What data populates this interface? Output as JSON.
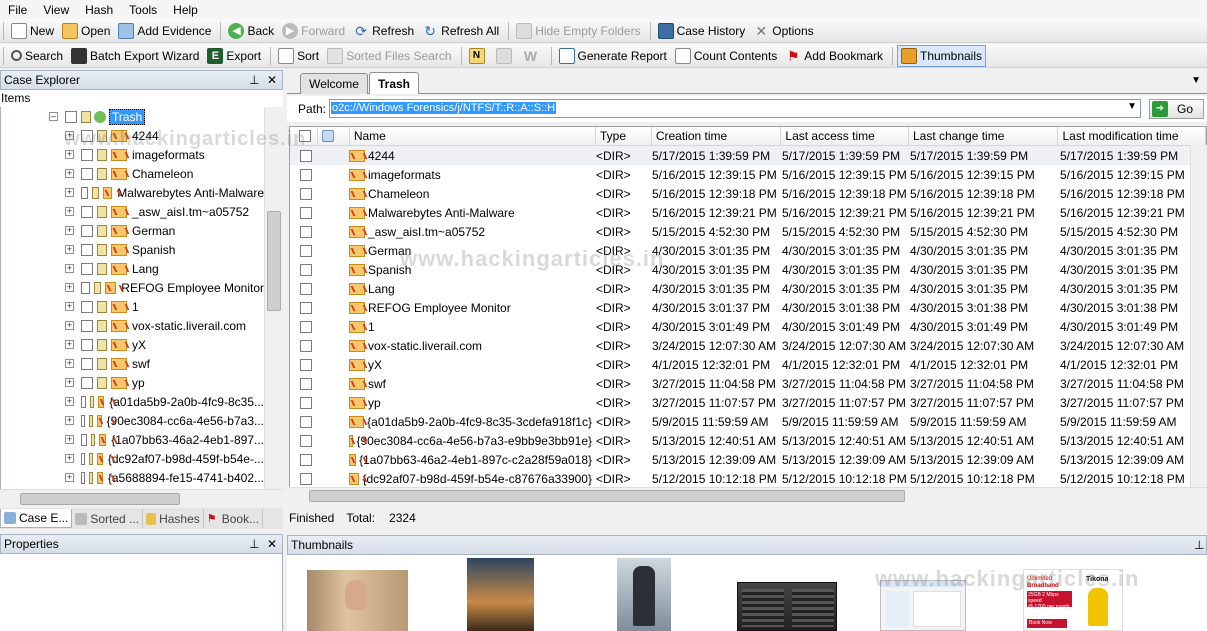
{
  "menu": [
    "File",
    "View",
    "Hash",
    "Tools",
    "Help"
  ],
  "toolbar1": {
    "new": "New",
    "open": "Open",
    "add_evidence": "Add Evidence",
    "back": "Back",
    "forward": "Forward",
    "refresh": "Refresh",
    "refresh_all": "Refresh All",
    "hide_empty": "Hide Empty Folders",
    "case_history": "Case History",
    "options": "Options"
  },
  "toolbar2": {
    "search": "Search",
    "batch_export": "Batch Export Wizard",
    "export": "Export",
    "sort": "Sort",
    "sorted_files_search": "Sorted Files Search",
    "generate_report": "Generate Report",
    "count_contents": "Count Contents",
    "add_bookmark": "Add Bookmark",
    "thumbnails": "Thumbnails"
  },
  "case_explorer": {
    "title": "Case Explorer",
    "items_label": "Items",
    "root": "Trash",
    "nodes": [
      "4244",
      "imageformats",
      "Chameleon",
      "Malwarebytes Anti-Malware",
      "_asw_aisI.tm~a05752",
      "German",
      "Spanish",
      "Lang",
      "REFOG Employee Monitor",
      "1",
      "vox-static.liverail.com",
      "yX",
      "swf",
      "yp",
      "{a01da5b9-2a0b-4fc9-8c35...",
      "{90ec3084-cc6a-4e56-b7a3...",
      "{1a07bb63-46a2-4eb1-897...",
      "{dc92af07-b98d-459f-b54e-...",
      "{a5688894-fe15-4741-b402..."
    ]
  },
  "left_tabs": [
    "Case E...",
    "Sorted ...",
    "Hashes",
    "Book..."
  ],
  "properties": {
    "title": "Properties"
  },
  "tabs": [
    "Welcome",
    "Trash"
  ],
  "path": {
    "label": "Path:",
    "value": "o2c://Windows Forensics/j/NTFS/T::R::A::S::H",
    "go": "Go"
  },
  "grid": {
    "headers": [
      "Name",
      "Type",
      "Creation time",
      "Last access time",
      "Last change time",
      "Last modification time"
    ],
    "rows": [
      [
        "4244",
        "<DIR>",
        "5/17/2015  1:39:59 PM",
        "5/17/2015  1:39:59 PM",
        "5/17/2015  1:39:59 PM",
        "5/17/2015  1:39:59 PM"
      ],
      [
        "imageformats",
        "<DIR>",
        "5/16/2015  12:39:15 PM",
        "5/16/2015  12:39:15 PM",
        "5/16/2015  12:39:15 PM",
        "5/16/2015  12:39:15 PM"
      ],
      [
        "Chameleon",
        "<DIR>",
        "5/16/2015  12:39:18 PM",
        "5/16/2015  12:39:18 PM",
        "5/16/2015  12:39:18 PM",
        "5/16/2015  12:39:18 PM"
      ],
      [
        "Malwarebytes Anti-Malware",
        "<DIR>",
        "5/16/2015  12:39:21 PM",
        "5/16/2015  12:39:21 PM",
        "5/16/2015  12:39:21 PM",
        "5/16/2015  12:39:21 PM"
      ],
      [
        "_asw_aisI.tm~a05752",
        "<DIR>",
        "5/15/2015  4:52:30 PM",
        "5/15/2015  4:52:30 PM",
        "5/15/2015  4:52:30 PM",
        "5/15/2015  4:52:30 PM"
      ],
      [
        "German",
        "<DIR>",
        "4/30/2015  3:01:35 PM",
        "4/30/2015  3:01:35 PM",
        "4/30/2015  3:01:35 PM",
        "4/30/2015  3:01:35 PM"
      ],
      [
        "Spanish",
        "<DIR>",
        "4/30/2015  3:01:35 PM",
        "4/30/2015  3:01:35 PM",
        "4/30/2015  3:01:35 PM",
        "4/30/2015  3:01:35 PM"
      ],
      [
        "Lang",
        "<DIR>",
        "4/30/2015  3:01:35 PM",
        "4/30/2015  3:01:35 PM",
        "4/30/2015  3:01:35 PM",
        "4/30/2015  3:01:35 PM"
      ],
      [
        "REFOG Employee Monitor",
        "<DIR>",
        "4/30/2015  3:01:37 PM",
        "4/30/2015  3:01:38 PM",
        "4/30/2015  3:01:38 PM",
        "4/30/2015  3:01:38 PM"
      ],
      [
        "1",
        "<DIR>",
        "4/30/2015  3:01:49 PM",
        "4/30/2015  3:01:49 PM",
        "4/30/2015  3:01:49 PM",
        "4/30/2015  3:01:49 PM"
      ],
      [
        "vox-static.liverail.com",
        "<DIR>",
        "3/24/2015  12:07:30 AM",
        "3/24/2015  12:07:30 AM",
        "3/24/2015  12:07:30 AM",
        "3/24/2015  12:07:30 AM"
      ],
      [
        "yX",
        "<DIR>",
        "4/1/2015  12:32:01 PM",
        "4/1/2015  12:32:01 PM",
        "4/1/2015  12:32:01 PM",
        "4/1/2015  12:32:01 PM"
      ],
      [
        "swf",
        "<DIR>",
        "3/27/2015  11:04:58 PM",
        "3/27/2015  11:04:58 PM",
        "3/27/2015  11:04:58 PM",
        "3/27/2015  11:04:58 PM"
      ],
      [
        "yp",
        "<DIR>",
        "3/27/2015  11:07:57 PM",
        "3/27/2015  11:07:57 PM",
        "3/27/2015  11:07:57 PM",
        "3/27/2015  11:07:57 PM"
      ],
      [
        "{a01da5b9-2a0b-4fc9-8c35-3cdefa918f1c}",
        "<DIR>",
        "5/9/2015  11:59:59 AM",
        "5/9/2015  11:59:59 AM",
        "5/9/2015  11:59:59 AM",
        "5/9/2015  11:59:59 AM"
      ],
      [
        "{90ec3084-cc6a-4e56-b7a3-e9bb9e3bb91e}",
        "<DIR>",
        "5/13/2015  12:40:51 AM",
        "5/13/2015  12:40:51 AM",
        "5/13/2015  12:40:51 AM",
        "5/13/2015  12:40:51 AM"
      ],
      [
        "{1a07bb63-46a2-4eb1-897c-c2a28f59a018}",
        "<DIR>",
        "5/13/2015  12:39:09 AM",
        "5/13/2015  12:39:09 AM",
        "5/13/2015  12:39:09 AM",
        "5/13/2015  12:39:09 AM"
      ],
      [
        "{dc92af07-b98d-459f-b54e-c87676a33900}",
        "<DIR>",
        "5/12/2015  10:12:18 PM",
        "5/12/2015  10:12:18 PM",
        "5/12/2015  10:12:18 PM",
        "5/12/2015  10:12:18 PM"
      ]
    ]
  },
  "status": {
    "state": "Finished",
    "total_label": "Total:",
    "total": "2324"
  },
  "thumbnails": {
    "title": "Thumbnails",
    "ad_lines": [
      "Tikona",
      "Unlimited",
      "Broadband",
      "25GB 2 Mbps speed",
      "@ 1700 per month",
      "Book Now"
    ]
  },
  "watermark": "www.hackingarticles.in",
  "colors": {
    "selection": "#3399ff",
    "accent": "#316ac5"
  }
}
